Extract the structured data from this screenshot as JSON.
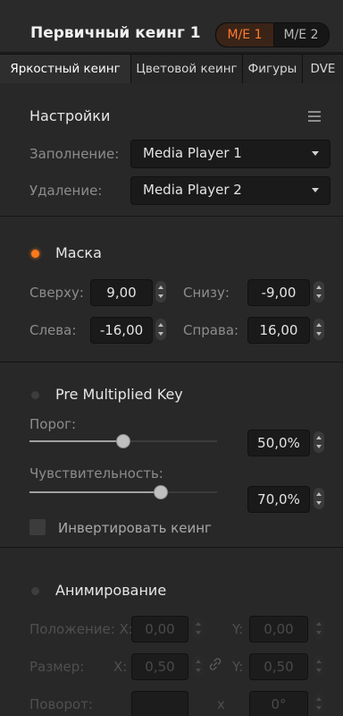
{
  "header": {
    "title": "Первичный кеинг 1",
    "me_options": [
      "M/E 1",
      "M/E 2"
    ],
    "me_selected": "M/E 1"
  },
  "tabs": [
    {
      "label": "Яркостный кеинг",
      "active": true
    },
    {
      "label": "Цветовой кеинг",
      "active": false
    },
    {
      "label": "Фигуры",
      "active": false
    },
    {
      "label": "DVE",
      "active": false
    }
  ],
  "settings": {
    "title": "Настройки",
    "fill_label": "Заполнение:",
    "fill_value": "Media Player 1",
    "cut_label": "Удаление:",
    "cut_value": "Media Player 2"
  },
  "mask": {
    "title": "Маска",
    "enabled": true,
    "top_label": "Сверху:",
    "top_value": "9,00",
    "bottom_label": "Снизу:",
    "bottom_value": "-9,00",
    "left_label": "Слева:",
    "left_value": "-16,00",
    "right_label": "Справа:",
    "right_value": "16,00"
  },
  "pre_multiplied": {
    "title": "Pre Multiplied Key",
    "enabled": false,
    "clip_label": "Порог:",
    "clip_value": "50,0%",
    "clip_fraction": 0.5,
    "gain_label": "Чувствительность:",
    "gain_value": "70,0%",
    "gain_fraction": 0.7,
    "invert_label": "Инвертировать кеинг",
    "invert_checked": false
  },
  "animation": {
    "title": "Анимирование",
    "enabled": false,
    "position_label": "Положение: X:",
    "position_x": "0,00",
    "position_y_label": "Y:",
    "position_y": "0,00",
    "size_label": "Размер:",
    "size_x_label": "X:",
    "size_x": "0,50",
    "size_y_label": "Y:",
    "size_y": "0,50",
    "rotation_label": "Поворот:",
    "rotation_x_label": "x",
    "rotation_value": "0°"
  },
  "colors": {
    "accent": "#ff7a1a",
    "background": "#282828",
    "field": "#1a1a1a"
  }
}
